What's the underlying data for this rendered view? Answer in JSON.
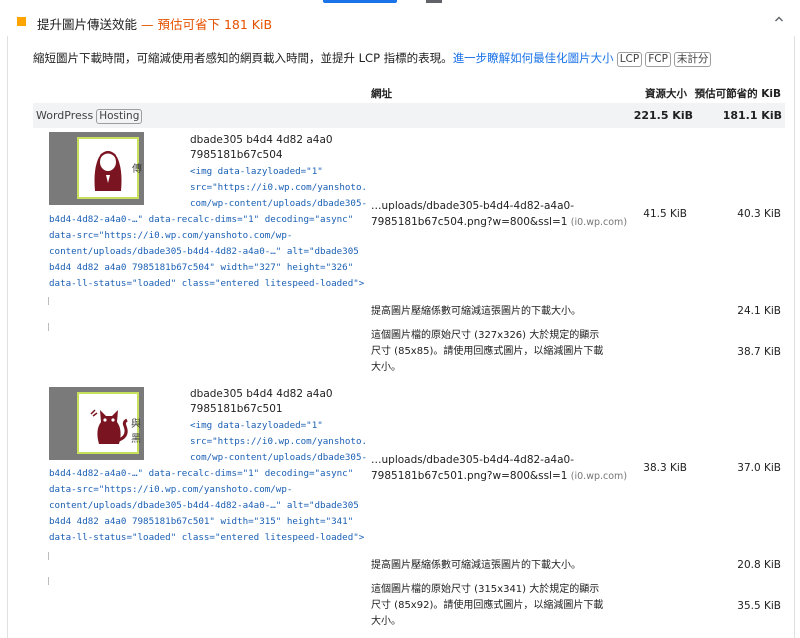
{
  "header": {
    "title": "提升圖片傳送效能",
    "savings": "— 預估可省下 181 KiB"
  },
  "description": {
    "text": "縮短圖片下載時間，可縮減使用者感知的網頁載入時間，並提升 LCP 指標的表現。",
    "link": "進一步瞭解如何最佳化圖片大小",
    "tags": [
      "LCP",
      "FCP",
      "未計分"
    ]
  },
  "table": {
    "columns": {
      "url": "網址",
      "resource_size": "資源大小",
      "est_savings": "預估可節省的 KiB"
    },
    "group": {
      "name": "WordPress",
      "tag": "Hosting",
      "resource_size": "221.5 KiB",
      "est_savings": "181.1 KiB"
    },
    "items": [
      {
        "thumb_ghost": "傳",
        "name_line1": "dbade305 b4d4 4d82 a4a0",
        "name_line2": "7985181b67c504",
        "code": [
          "<img data-lazyloaded=\"1\"",
          "src=\"https://i0.wp.com/yanshoto.",
          "com/wp-content/uploads/dbade305-",
          "b4d4-4d82-a4a0-…\" data-recalc-dims=\"1\" decoding=\"async\"",
          "data-src=\"https://i0.wp.com/yanshoto.com/wp-",
          "content/uploads/dbade305-b4d4-4d82-a4a0-…\" alt=\"dbade305",
          "b4d4 4d82 a4a0 7985181b67c504\" width=\"327\" height=\"326\"",
          "data-ll-status=\"loaded\" class=\"entered litespeed-loaded\">"
        ],
        "url_line1": "…uploads/dbade305-b4d4-4d82-a4a0-",
        "url_line2": "7985181b67c504.png?w=800&ssl=1",
        "host": "(i0.wp.com)",
        "resource_size": "41.5 KiB",
        "est_savings": "40.3 KiB",
        "sub_compress": "提高圖片壓縮係數可縮減這張圖片的下載大小。",
        "sub_compress_savings": "24.1 KiB",
        "sub_resize": [
          "這個圖片檔的原始尺寸 (327x326) 大於規定的顯示",
          "尺寸 (85x85)。請使用回應式圖片，以縮減圖片下載",
          "大小。"
        ],
        "sub_resize_savings": "38.7 KiB"
      },
      {
        "thumb_ghost": "與黑",
        "name_line1": "dbade305 b4d4 4d82 a4a0",
        "name_line2": "7985181b67c501",
        "code": [
          "<img data-lazyloaded=\"1\"",
          "src=\"https://i0.wp.com/yanshoto.",
          "com/wp-content/uploads/dbade305-",
          "b4d4-4d82-a4a0-…\" data-recalc-dims=\"1\" decoding=\"async\"",
          "data-src=\"https://i0.wp.com/yanshoto.com/wp-",
          "content/uploads/dbade305-b4d4-4d82-a4a0-…\" alt=\"dbade305",
          "b4d4 4d82 a4a0 7985181b67c501\" width=\"315\" height=\"341\"",
          "data-ll-status=\"loaded\" class=\"entered litespeed-loaded\">"
        ],
        "url_line1": "…uploads/dbade305-b4d4-4d82-a4a0-",
        "url_line2": "7985181b67c501.png?w=800&ssl=1",
        "host": "(i0.wp.com)",
        "resource_size": "38.3 KiB",
        "est_savings": "37.0 KiB",
        "sub_compress": "提高圖片壓縮係數可縮減這張圖片的下載大小。",
        "sub_compress_savings": "20.8 KiB",
        "sub_resize": [
          "這個圖片檔的原始尺寸 (315x341) 大於規定的顯示",
          "尺寸 (85x92)。請使用回應式圖片，以縮減圖片下載",
          "大小。"
        ],
        "sub_resize_savings": "35.5 KiB"
      }
    ]
  }
}
